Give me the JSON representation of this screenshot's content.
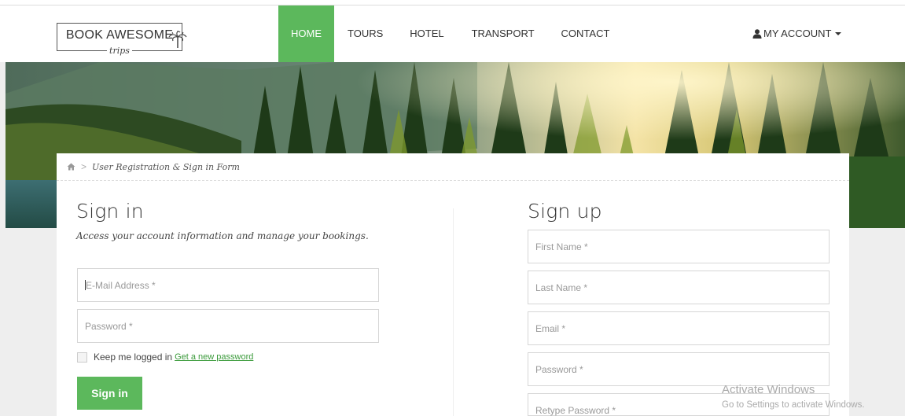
{
  "logo": {
    "title": "BOOK AWESOME",
    "script": "trips"
  },
  "nav": {
    "items": [
      {
        "label": "HOME",
        "active": true
      },
      {
        "label": "TOURS"
      },
      {
        "label": "HOTEL"
      },
      {
        "label": "TRANSPORT"
      },
      {
        "label": "CONTACT"
      }
    ],
    "account_label": "MY ACCOUNT",
    "active_color": "#5cb85c"
  },
  "breadcrumb": {
    "current": "User Registration & Sign in Form",
    "separator": ">"
  },
  "signin": {
    "title": "Sign in",
    "subtitle": "Access your account information and manage your bookings.",
    "email_placeholder": "E-Mail Address *",
    "password_placeholder": "Password *",
    "remember_label": "Keep me logged in",
    "forgot_link": "Get a new password",
    "button": "Sign in"
  },
  "signup": {
    "title": "Sign up",
    "first_name_placeholder": "First Name *",
    "last_name_placeholder": "Last Name *",
    "email_placeholder": "Email *",
    "password_placeholder": "Password *",
    "retype_password_placeholder": "Retype Password *"
  },
  "watermark": {
    "line1": "Activate Windows",
    "line2": "Go to Settings to activate Windows."
  },
  "icons": [
    "home-icon",
    "user-icon",
    "caret-down-icon",
    "palm-tree-icon"
  ]
}
